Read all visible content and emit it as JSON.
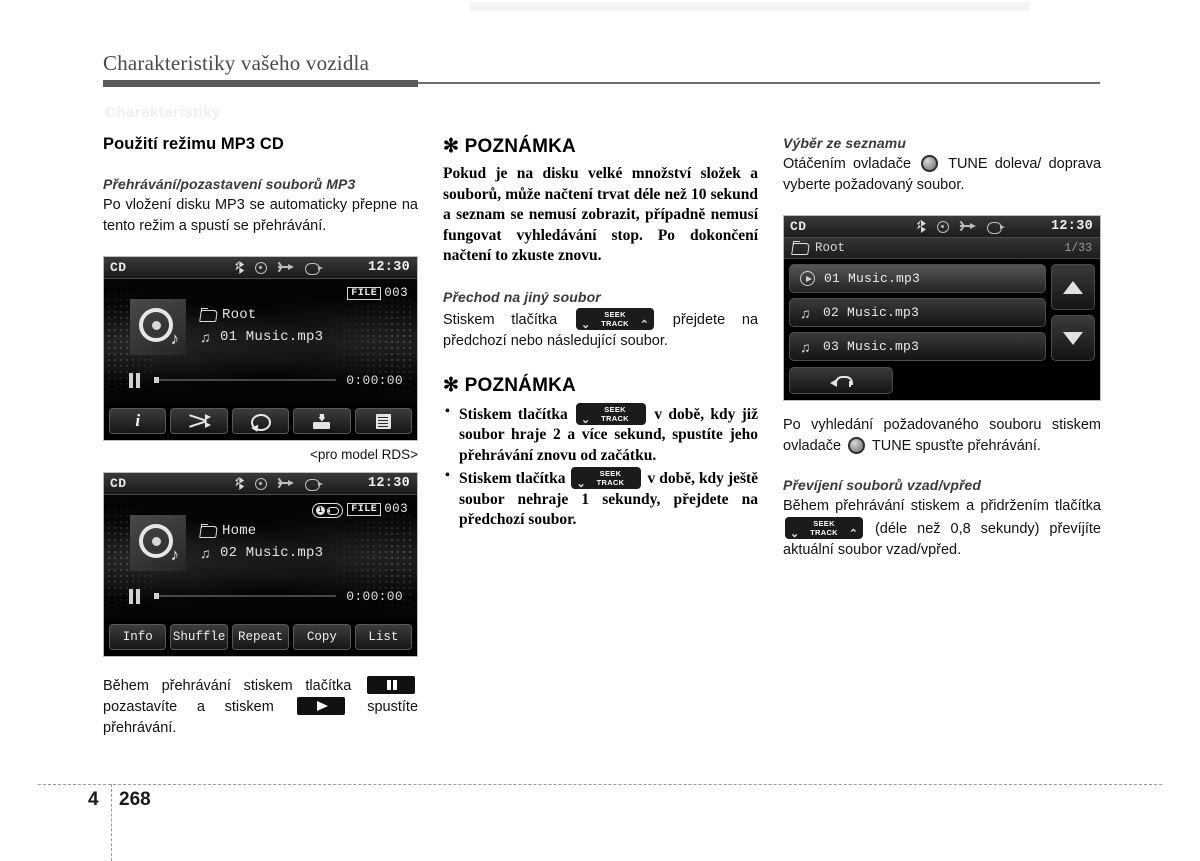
{
  "header": {
    "chapter_title": "Charakteristiky vašeho vozidla"
  },
  "footer": {
    "chapter_number": "4",
    "page_number": "268"
  },
  "col1": {
    "heading": "Použití režimu MP3 CD",
    "sub1": "Přehrávání/pozastavení souborů MP3",
    "para1": "Po vložení disku MP3 se automaticky přepne na tento režim a spustí se přehrávání.",
    "caption_rds": "<pro model RDS>",
    "para2_a": "Během přehrávání stiskem tlačítka",
    "para2_b": "pozastavíte a stiskem",
    "para2_c": "spustíte přehrávání."
  },
  "col2": {
    "note1_title": "✻ POZNÁMKA",
    "note1_body": "Pokud je na disku velké množství složek a souborů, může načtení trvat déle než 10 sekund a seznam se nemusí zobrazit, případně nemusí fungovat vyhledávání stop. Po dokončení načtení to zkuste znovu.",
    "sub2": "Přechod na jiný soubor",
    "para3_a": "Stiskem tlačítka",
    "para3_b": "přejdete na předchozí nebo následující soubor.",
    "note2_title": "✻ POZNÁMKA",
    "bullet1_a": "Stiskem tlačítka",
    "bullet1_b": "v době, kdy již soubor hraje 2 a více sekund, spustíte jeho přehrávání znovu od začátku.",
    "bullet2_a": "Stiskem tlačítka",
    "bullet2_b": "v době, kdy ještě soubor nehraje 1 sekundy, přejdete na předchozí soubor."
  },
  "col3": {
    "sub1": "Výběr ze seznamu",
    "para1_a": "Otáčením ovladače",
    "para1_b": "TUNE doleva/ doprava vyberte požadovaný soubor.",
    "para2_a": "Po vyhledání požadovaného souboru stiskem ovladače",
    "para2_b": "TUNE spusťte přehrávání.",
    "sub2": "Převíjení souborů vzad/vpřed",
    "para3_a": "Během přehrávání stiskem a přidržením tlačítka",
    "para3_b": "(déle než 0,8 sekundy) převíjíte aktuální soubor vzad/vpřed."
  },
  "seek_button": {
    "line1": "SEEK",
    "line2": "TRACK",
    "chev_left": "⌄",
    "chev_right": "⌃"
  },
  "screen1": {
    "source": "CD",
    "clock": "12:30",
    "file_label": "FILE",
    "file_number": "003",
    "folder": "Root",
    "track": "01 Music.mp3",
    "time": "0:00:00",
    "buttons": [
      {
        "name": "info",
        "label": ""
      },
      {
        "name": "shuffle",
        "label": ""
      },
      {
        "name": "repeat",
        "label": ""
      },
      {
        "name": "copy",
        "label": ""
      },
      {
        "name": "list",
        "label": ""
      }
    ]
  },
  "screen2": {
    "source": "CD",
    "clock": "12:30",
    "file_label": "FILE",
    "file_number": "003",
    "repeat_indicator": "1",
    "folder": "Home",
    "track": "02 Music.mp3",
    "time": "0:00:00",
    "buttons": [
      {
        "label": "Info"
      },
      {
        "label": "Shuffle"
      },
      {
        "label": "Repeat"
      },
      {
        "label": "Copy"
      },
      {
        "label": "List"
      }
    ]
  },
  "screen3": {
    "source": "CD",
    "clock": "12:30",
    "folder": "Root",
    "count": "1/33",
    "items": [
      {
        "label": "01 Music.mp3",
        "selected": true
      },
      {
        "label": "02 Music.mp3",
        "selected": false
      },
      {
        "label": "03 Music.mp3",
        "selected": false
      }
    ]
  },
  "ghost_text": "Charakteristiky"
}
